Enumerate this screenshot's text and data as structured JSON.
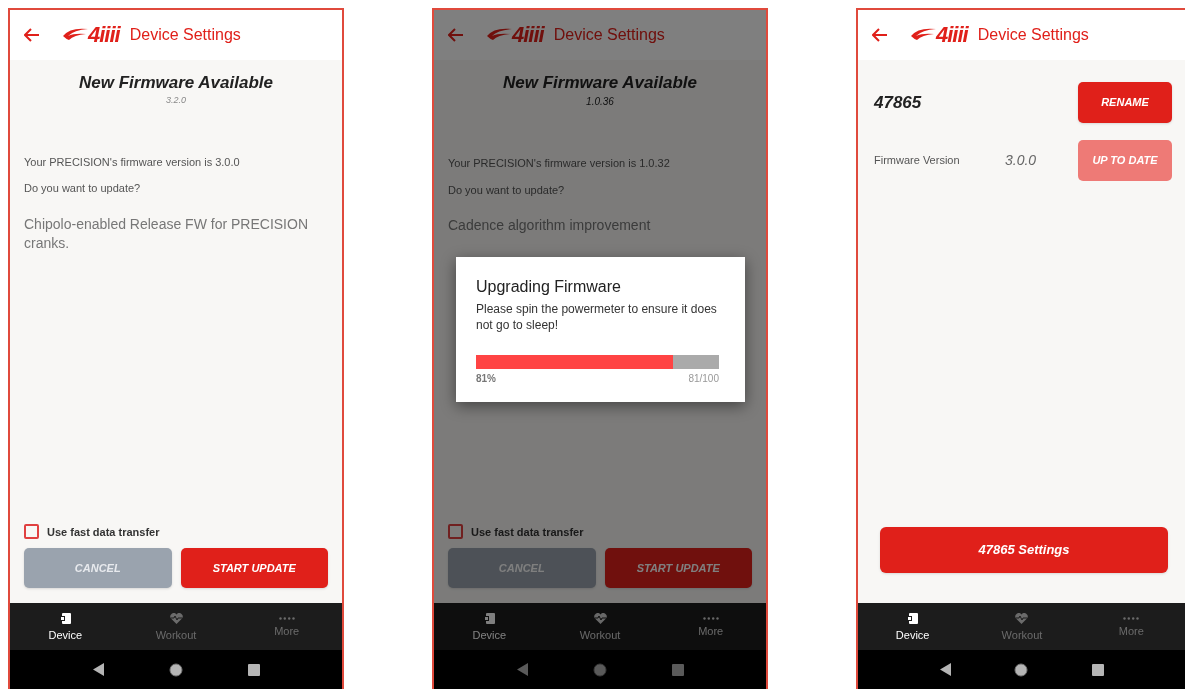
{
  "screens": [
    {
      "kind": "update",
      "header": {
        "logo": "4iiii",
        "title": "Device Settings"
      },
      "heading": "New Firmware Available",
      "new_version": "3.2.0",
      "current_text": "Your PRECISION's firmware version is 3.0.0",
      "question": "Do you want to update?",
      "notes": "Chipolo-enabled Release FW for PRECISION cranks.",
      "checkbox": {
        "label": "Use fast data transfer",
        "checked": false
      },
      "buttons": [
        {
          "label": "CANCEL",
          "kind": "secondary"
        },
        {
          "label": "START UPDATE",
          "kind": "primary"
        }
      ],
      "nav": [
        {
          "label": "Device",
          "kind": "device",
          "selected": true
        },
        {
          "label": "Workout",
          "kind": "workout",
          "selected": false
        },
        {
          "label": "More",
          "kind": "more",
          "selected": false
        }
      ]
    },
    {
      "kind": "update",
      "header": {
        "logo": "4iiii",
        "title": "Device Settings"
      },
      "heading": "New Firmware Available",
      "new_version": "1.0.36",
      "current_text": "Your PRECISION's firmware version is 1.0.32",
      "question": "Do you want to update?",
      "notes": "Cadence algorithm improvement",
      "checkbox": {
        "label": "Use fast data transfer",
        "checked": false
      },
      "buttons": [
        {
          "label": "CANCEL",
          "kind": "secondary"
        },
        {
          "label": "START UPDATE",
          "kind": "primary"
        }
      ],
      "nav": [
        {
          "label": "Device",
          "kind": "device",
          "selected": true
        },
        {
          "label": "Workout",
          "kind": "workout",
          "selected": false
        },
        {
          "label": "More",
          "kind": "more",
          "selected": false
        }
      ],
      "dialog": {
        "title": "Upgrading Firmware",
        "message": "Please spin the powermeter to ensure it does not go to sleep!",
        "level": 0.81,
        "percent": "81%",
        "count": "81/100"
      }
    },
    {
      "kind": "device",
      "header": {
        "logo": "4iiii",
        "title": "Device Settings"
      },
      "device_name": "47865",
      "rename_button": "RENAME",
      "firmware_label": "Firmware Version",
      "firmware_version": "3.0.0",
      "status_button": {
        "label": "UP TO DATE",
        "disabled": true
      },
      "settings_button": "47865 Settings",
      "nav": [
        {
          "label": "Device",
          "kind": "device",
          "selected": true
        },
        {
          "label": "Workout",
          "kind": "workout",
          "selected": false
        },
        {
          "label": "More",
          "kind": "more",
          "selected": false
        }
      ]
    }
  ]
}
